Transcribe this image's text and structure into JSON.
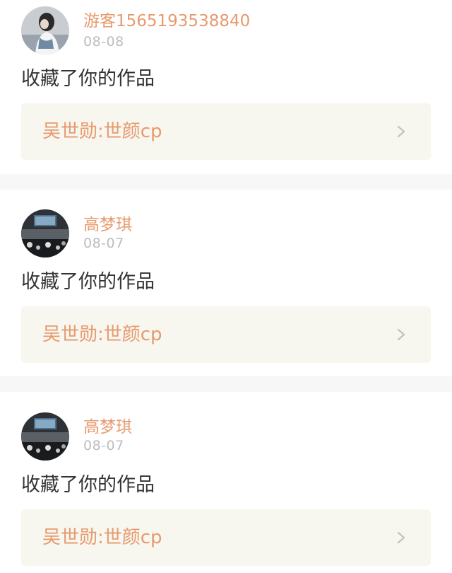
{
  "notifications": [
    {
      "username": "游客1565193538840",
      "date": "08-08",
      "action": "收藏了你的作品",
      "work_title": "吴世勋:世颜cp",
      "avatar_icon": "avatar-girl-photo"
    },
    {
      "username": "高梦琪",
      "date": "08-07",
      "action": "收藏了你的作品",
      "work_title": "吴世勋:世颜cp",
      "avatar_icon": "avatar-concert-photo"
    },
    {
      "username": "高梦琪",
      "date": "08-07",
      "action": "收藏了你的作品",
      "work_title": "吴世勋:世颜cp",
      "avatar_icon": "avatar-concert-photo"
    }
  ],
  "colors": {
    "accent": "#e79a6e",
    "date": "#bdbdbd",
    "link_bg": "#f7f6ef",
    "divider": "#f7f7f7"
  }
}
